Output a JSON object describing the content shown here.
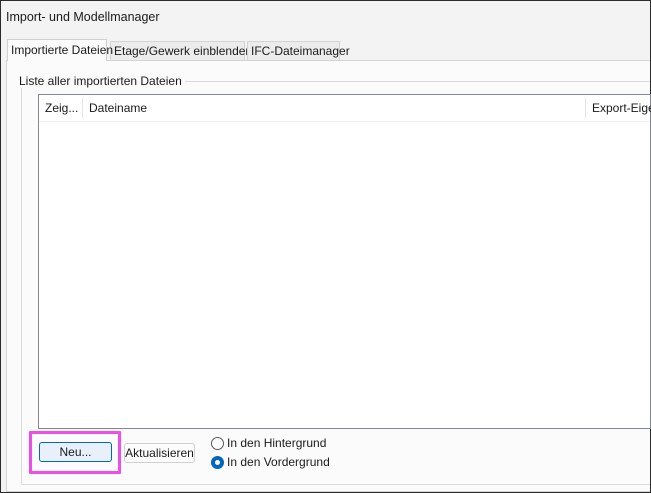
{
  "window": {
    "title": "Import- und Modellmanager"
  },
  "tabs": [
    {
      "label": "Importierte Dateien",
      "active": true
    },
    {
      "label": "Etage/Gewerk einblenden",
      "active": false
    },
    {
      "label": "IFC-Dateimanager",
      "active": false
    }
  ],
  "file_list": {
    "group_label": "Liste aller importierten Dateien",
    "columns": [
      "Zeig...",
      "Dateiname",
      "Export-Eigen"
    ],
    "rows": []
  },
  "buttons": {
    "new_label": "Neu...",
    "refresh_label": "Aktualisieren"
  },
  "placement": {
    "options": [
      {
        "label": "In den Hintergrund",
        "selected": false
      },
      {
        "label": "In den Vordergrund",
        "selected": true
      }
    ]
  },
  "colors": {
    "accent": "#0067c0",
    "highlight": "#ef4de8"
  }
}
